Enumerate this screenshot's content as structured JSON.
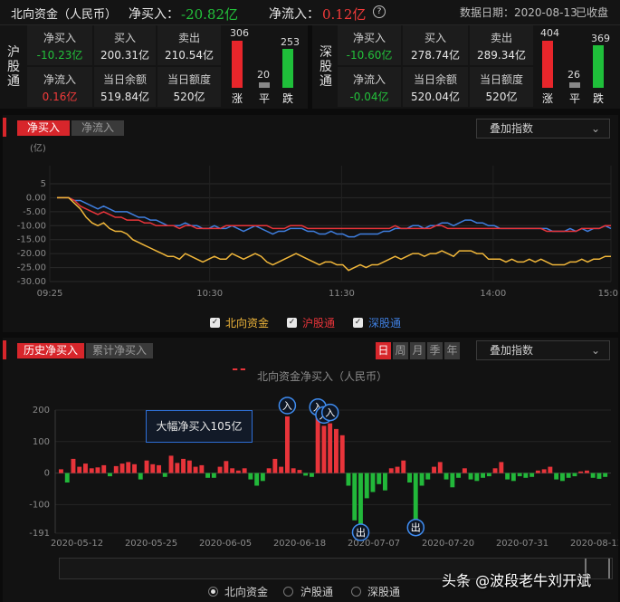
{
  "header": {
    "title": "北向资金（人民币）",
    "net_buy_label": "净买入：",
    "net_buy_value": "-20.82亿",
    "net_inflow_label": "净流入：",
    "net_inflow_value": "0.12亿",
    "help_icon": "?",
    "date_label": "数据日期：2020-08-13",
    "status": "已收盘"
  },
  "sh": {
    "name": "沪股通",
    "net_buy_label": "净买入",
    "net_buy": "-10.23亿",
    "buy_label": "买入",
    "buy": "200.31亿",
    "sell_label": "卖出",
    "sell": "210.54亿",
    "net_inflow_label": "净流入",
    "net_inflow": "0.16亿",
    "balance_label": "当日余额",
    "balance": "519.84亿",
    "quota_label": "当日额度",
    "quota": "520亿",
    "up_count": "306",
    "flat_count": "20",
    "down_count": "253",
    "up_label": "涨",
    "flat_label": "平",
    "down_label": "跌"
  },
  "sz": {
    "name": "深股通",
    "net_buy_label": "净买入",
    "net_buy": "-10.60亿",
    "buy_label": "买入",
    "buy": "278.74亿",
    "sell_label": "卖出",
    "sell": "289.34亿",
    "net_inflow_label": "净流入",
    "net_inflow": "-0.04亿",
    "balance_label": "当日余额",
    "balance": "520.04亿",
    "quota_label": "当日额度",
    "quota": "520亿",
    "up_count": "404",
    "flat_count": "26",
    "down_count": "369",
    "up_label": "涨",
    "flat_label": "平",
    "down_label": "跌"
  },
  "intraday": {
    "tab_net_buy": "净买入",
    "tab_net_inflow": "净流入",
    "overlay_label": "叠加指数",
    "legend": {
      "north": "北向资金",
      "sh": "沪股通",
      "sz": "深股通"
    },
    "colors": {
      "north": "#f0b63a",
      "sh": "#e8343a",
      "sz": "#3f7fe0"
    }
  },
  "history": {
    "tab_hist": "历史净买入",
    "tab_cum": "累计净买入",
    "periods": [
      "日",
      "周",
      "月",
      "季",
      "年"
    ],
    "overlay_label": "叠加指数",
    "legend": "北向资金净买入（人民币）",
    "annotation": "大幅净买入105亿",
    "marker_in": "入",
    "marker_out": "出",
    "radio": {
      "north": "北向资金",
      "sh": "沪股通",
      "sz": "深股通"
    }
  },
  "watermark": "头条 @波段老牛刘开斌",
  "chart_data": [
    {
      "type": "line",
      "title": "",
      "ylabel": "(亿)",
      "ylim": [
        -30,
        5
      ],
      "yticks": [
        "5",
        "0.00",
        "-5.00",
        "-10.00",
        "-15.00",
        "-20.00",
        "-25.00",
        "-30.00"
      ],
      "xticks": [
        "09:25",
        "10:30",
        "11:30",
        "14:00",
        "15:00"
      ],
      "series": [
        {
          "name": "北向资金",
          "values": [
            0,
            0,
            0,
            -2,
            -4,
            -7,
            -9,
            -10,
            -9,
            -11,
            -12,
            -12,
            -13,
            -15,
            -16,
            -17,
            -18,
            -19,
            -20,
            -21,
            -21,
            -22,
            -20,
            -21,
            -22,
            -23,
            -22,
            -21,
            -22,
            -22,
            -20,
            -21,
            -22,
            -21,
            -20,
            -21,
            -23,
            -24,
            -23,
            -22,
            -21,
            -20,
            -21,
            -22,
            -23,
            -24,
            -23,
            -23,
            -24,
            -24,
            -26,
            -25,
            -24,
            -25,
            -24,
            -24,
            -23,
            -22,
            -21,
            -22,
            -21,
            -20,
            -20,
            -21,
            -20,
            -20,
            -19,
            -20,
            -21,
            -19,
            -19,
            -19,
            -20,
            -20,
            -22,
            -22,
            -22,
            -23,
            -22,
            -23,
            -23,
            -22,
            -23,
            -22,
            -23,
            -24,
            -24,
            -24,
            -23,
            -23,
            -22,
            -23,
            -22,
            -22,
            -21,
            -21
          ]
        },
        {
          "name": "沪股通",
          "values": [
            0,
            0,
            0,
            -1,
            -3,
            -4,
            -5,
            -6,
            -5,
            -6,
            -7,
            -7,
            -8,
            -8,
            -8,
            -9,
            -9,
            -10,
            -10,
            -10,
            -10,
            -11,
            -10,
            -10,
            -11,
            -11,
            -11,
            -11,
            -11,
            -10,
            -10,
            -10,
            -10,
            -10,
            -10,
            -10,
            -10,
            -11,
            -11,
            -11,
            -10,
            -10,
            -10,
            -11,
            -11,
            -11,
            -11,
            -11,
            -11,
            -11,
            -11,
            -11,
            -11,
            -11,
            -11,
            -11,
            -11,
            -11,
            -10,
            -11,
            -11,
            -11,
            -11,
            -11,
            -11,
            -10,
            -10,
            -11,
            -11,
            -11,
            -11,
            -11,
            -11,
            -11,
            -11,
            -11,
            -11,
            -11,
            -11,
            -11,
            -11,
            -11,
            -11,
            -11,
            -12,
            -12,
            -12,
            -12,
            -12,
            -12,
            -11,
            -11,
            -11,
            -11,
            -10,
            -10
          ]
        },
        {
          "name": "深股通",
          "values": [
            0,
            0,
            0,
            -1,
            -1,
            -2,
            -3,
            -4,
            -3,
            -4,
            -5,
            -5,
            -5,
            -6,
            -7,
            -7,
            -8,
            -8,
            -9,
            -10,
            -10,
            -10,
            -9,
            -10,
            -10,
            -11,
            -11,
            -10,
            -11,
            -11,
            -10,
            -11,
            -12,
            -11,
            -10,
            -11,
            -12,
            -13,
            -12,
            -12,
            -11,
            -11,
            -11,
            -12,
            -12,
            -13,
            -13,
            -12,
            -13,
            -13,
            -14,
            -14,
            -13,
            -13,
            -13,
            -13,
            -12,
            -12,
            -11,
            -11,
            -11,
            -10,
            -10,
            -11,
            -10,
            -10,
            -9,
            -9,
            -10,
            -9,
            -8,
            -8,
            -9,
            -9,
            -10,
            -10,
            -11,
            -11,
            -11,
            -11,
            -11,
            -11,
            -11,
            -11,
            -11,
            -12,
            -12,
            -12,
            -11,
            -12,
            -11,
            -12,
            -11,
            -11,
            -10,
            -11
          ]
        }
      ]
    },
    {
      "type": "bar",
      "title": "",
      "ylabel": "",
      "ylim": [
        -191,
        200
      ],
      "yticks": [
        "200",
        "100",
        "0",
        "-100",
        "-191"
      ],
      "xticks": [
        "2020-05-12",
        "2020-05-25",
        "2020-06-05",
        "2020-06-18",
        "2020-07-07",
        "2020-07-20",
        "2020-07-31",
        "2020-08-13"
      ],
      "series": [
        {
          "name": "北向资金净买入（人民币）",
          "values": [
            12,
            -30,
            45,
            20,
            30,
            15,
            18,
            25,
            -10,
            22,
            30,
            35,
            28,
            -20,
            40,
            28,
            25,
            -12,
            55,
            32,
            45,
            40,
            20,
            25,
            -15,
            -15,
            20,
            38,
            15,
            8,
            15,
            -20,
            -40,
            -25,
            15,
            45,
            20,
            180,
            15,
            10,
            -8,
            -12,
            175,
            150,
            158,
            140,
            120,
            -40,
            -150,
            -165,
            -80,
            -60,
            -35,
            -55,
            15,
            20,
            40,
            -30,
            -150,
            -40,
            -20,
            20,
            35,
            -20,
            -45,
            -15,
            15,
            -20,
            -25,
            -15,
            -10,
            15,
            35,
            -20,
            -25,
            -10,
            -15,
            -12,
            8,
            12,
            20,
            -20,
            -25,
            -15,
            -10,
            5,
            8,
            -15,
            -18,
            -12
          ]
        }
      ]
    }
  ]
}
